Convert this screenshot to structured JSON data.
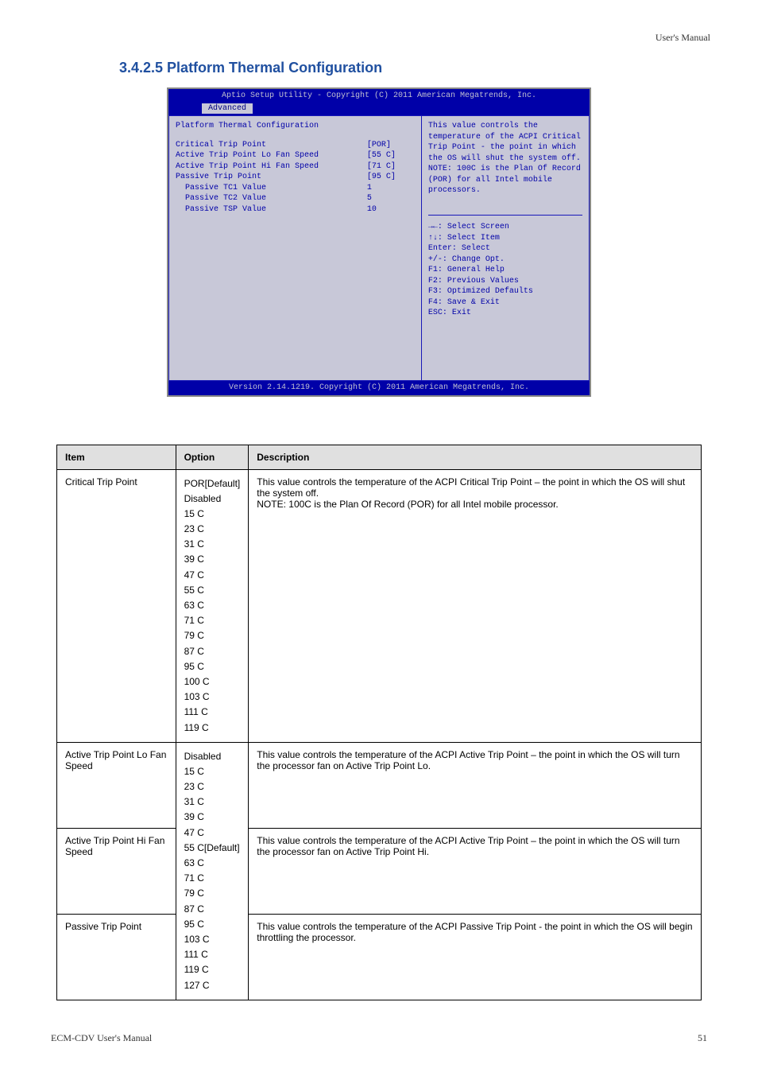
{
  "header_right": "User's Manual",
  "section_title": "3.4.2.5 Platform Thermal Configuration",
  "bios": {
    "title": "Aptio Setup Utility - Copyright (C) 2011 American Megatrends, Inc.",
    "tab": "Advanced",
    "heading": "Platform Thermal Configuration",
    "rows": [
      {
        "label": "Critical Trip Point",
        "value": "[POR]"
      },
      {
        "label": "Active Trip Point Lo Fan Speed",
        "value": "[55 C]"
      },
      {
        "label": "Active Trip Point Hi Fan Speed",
        "value": "[71 C]"
      },
      {
        "label": "Passive Trip Point",
        "value": "[95 C]"
      },
      {
        "label": "  Passive TC1 Value",
        "value": "1"
      },
      {
        "label": "  Passive TC2 Value",
        "value": "5"
      },
      {
        "label": "  Passive TSP Value",
        "value": "10"
      }
    ],
    "help_top": "This value controls the temperature of the ACPI Critical Trip Point - the point in which the OS will shut the system off.\nNOTE:  100C is the Plan Of Record (POR) for all Intel mobile processors.",
    "help_bottom": [
      "→←: Select Screen",
      "↑↓: Select Item",
      "Enter: Select",
      "+/-: Change Opt.",
      "F1: General Help",
      "F2: Previous Values",
      "F3: Optimized Defaults",
      "F4: Save & Exit",
      "ESC: Exit"
    ],
    "footer": "Version 2.14.1219. Copyright (C) 2011 American Megatrends, Inc."
  },
  "table": {
    "headers": [
      "Item",
      "Option",
      "Description"
    ],
    "rows": [
      {
        "item": "Critical Trip Point",
        "opts": "POR[Default]\nDisabled\n15 C\n23 C\n31 C\n39 C\n47 C\n55 C\n63 C\n71 C\n79 C\n87 C\n95 C\n100 C\n103 C\n111 C\n119 C",
        "desc": "This value controls the temperature of the ACPI Critical Trip Point – the point in which the OS will shut the system off.\nNOTE: 100C is the Plan Of Record (POR) for all Intel mobile processor."
      },
      {
        "item": "Active Trip Point Lo Fan Speed",
        "opts": null,
        "desc": "This value controls the temperature of the ACPI Active Trip Point – the point in which the OS will turn the processor fan on Active Trip Point Lo."
      },
      {
        "item": "Active Trip Point Hi Fan Speed",
        "opts": null,
        "desc": "This value controls the temperature of the ACPI Active Trip Point – the point in which the OS will turn the processor fan on Active Trip Point Hi."
      },
      {
        "item": "Passive Trip Point",
        "opts": "Disabled\n15 C\n23 C\n31 C\n39 C\n47 C\n55 C[Default]\n63 C\n71 C\n79 C\n87 C\n95 C\n103 C\n111 C\n119 C\n127 C",
        "desc": "This value controls the temperature of the ACPI Passive Trip Point - the point in which the OS will begin throttling the processor."
      }
    ]
  },
  "footer_left": "ECM-CDV User's Manual",
  "footer_right": "51"
}
